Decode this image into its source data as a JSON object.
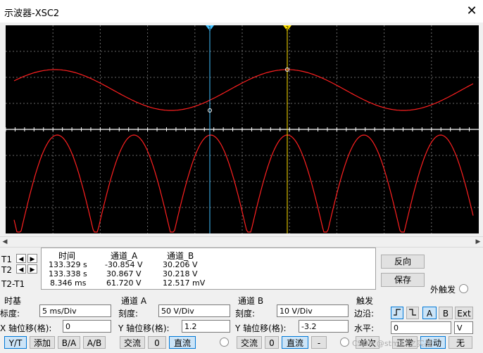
{
  "window": {
    "title": "示波器-XSC2"
  },
  "cursors": {
    "t1_marker": "1",
    "t2_marker": "2"
  },
  "measure": {
    "headers": {
      "time": "时间",
      "ch_a": "通道_A",
      "ch_b": "通道_B"
    },
    "rows": [
      {
        "label": "T1",
        "time": "133.329 s",
        "a": "-30.854 V",
        "b": "30.206 V"
      },
      {
        "label": "T2",
        "time": "133.338 s",
        "a": "30.867 V",
        "b": "30.218 V"
      },
      {
        "label": "T2-T1",
        "time": "8.346 ms",
        "a": "61.720 V",
        "b": "12.517 mV"
      }
    ]
  },
  "buttons": {
    "reverse": "反向",
    "save": "保存"
  },
  "ext_trigger_label": "外触发",
  "timebase": {
    "section": "时基",
    "scale_label": "标度:",
    "scale": "5 ms/Div",
    "xpos_label": "X 轴位移(格):",
    "xpos": "0",
    "modes": [
      "Y/T",
      "添加",
      "B/A",
      "A/B"
    ]
  },
  "channel_a": {
    "section": "通道 A",
    "scale_label": "刻度:",
    "scale": "50 V/Div",
    "ypos_label": "Y 轴位移(格):",
    "ypos": "1.2",
    "coupling": [
      "交流",
      "0",
      "直流"
    ]
  },
  "channel_b": {
    "section": "通道 B",
    "scale_label": "刻度:",
    "scale": "10 V/Div",
    "ypos_label": "Y 轴位移(格):",
    "ypos": "-3.2",
    "coupling": [
      "交流",
      "0",
      "直流",
      "-"
    ]
  },
  "trigger": {
    "section": "触发",
    "edge_label": "边沿:",
    "edge_sources": [
      "A",
      "B",
      "Ext"
    ],
    "level_label": "水平:",
    "level": "0",
    "level_unit": "V",
    "modes": [
      "单次",
      "正常",
      "自动",
      "无"
    ]
  },
  "watermark": "CSDN @stm32之实战",
  "colors": {
    "trace": "#ff2020",
    "cursor1": "#40c0ff",
    "cursor2": "#ffe000",
    "screen": "#000000"
  },
  "icons": {
    "close": "close-icon",
    "left": "arrow-left-icon",
    "right": "arrow-right-icon"
  }
}
